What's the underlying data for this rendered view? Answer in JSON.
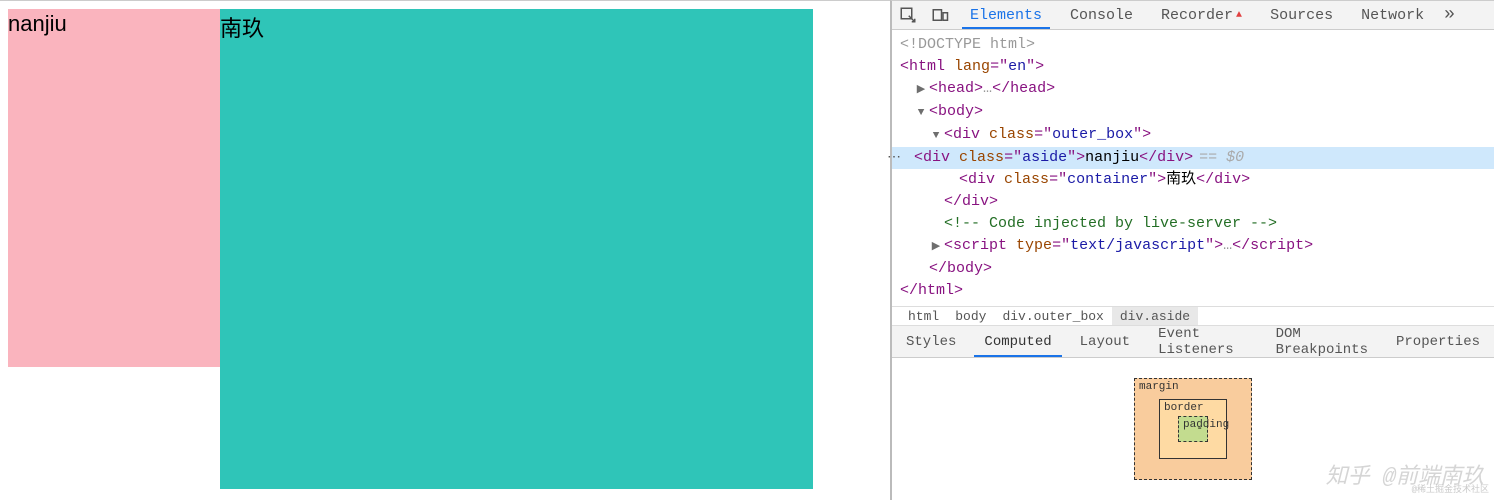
{
  "viewport": {
    "aside_text": "nanjiu",
    "container_text": "南玖"
  },
  "devtools": {
    "tabs": [
      "Elements",
      "Console",
      "Recorder",
      "Sources",
      "Network"
    ],
    "active_tab": "Elements"
  },
  "dom": {
    "doctype": "<!DOCTYPE html>",
    "html_open": "html",
    "html_lang_attr": "lang",
    "html_lang_val": "en",
    "head": "head",
    "body": "body",
    "outer_class_attr": "class",
    "outer_class_val": "outer_box",
    "div": "div",
    "aside_class_val": "aside",
    "aside_text": "nanjiu",
    "eq_dollar": "== $0",
    "container_class_val": "container",
    "container_text": "南玖",
    "comment": "<!-- Code injected by live-server -->",
    "script": "script",
    "script_type_attr": "type",
    "script_type_val": "text/javascript",
    "html_close": "html",
    "body_close": "body",
    "div_close": "div"
  },
  "breadcrumb": [
    "html",
    "body",
    "div.outer_box",
    "div.aside"
  ],
  "breadcrumb_active": "div.aside",
  "styles_tabs": [
    "Styles",
    "Computed",
    "Layout",
    "Event Listeners",
    "DOM Breakpoints",
    "Properties"
  ],
  "styles_active": "Computed",
  "box_model": {
    "margin_label": "margin",
    "border_label": "border",
    "padding_label": "padding",
    "dash": "-"
  },
  "watermark": "知乎 @前端南玖",
  "watermark_small": "@稀土掘金技术社区"
}
